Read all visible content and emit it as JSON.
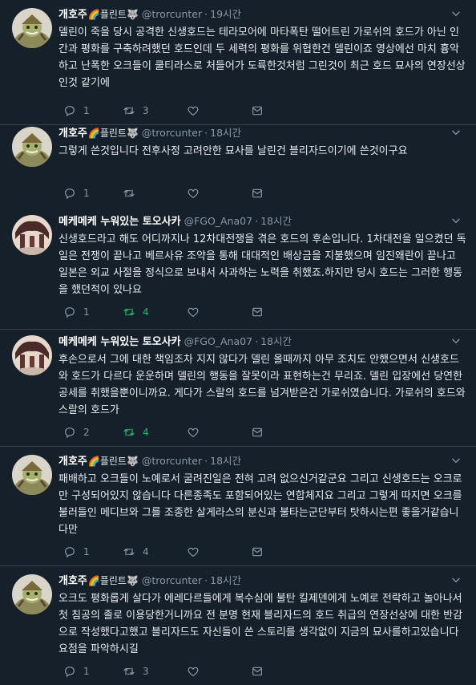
{
  "tweets": [
    {
      "name": "개호주",
      "emoji": "🌈플린트🐺",
      "handle": "@trorcunter",
      "time": "19시간",
      "text": "델린이 죽을 당시 공격한 신생호드는 테라모어에 마타폭탄 떨어트린 가로쉬의 호드가 아닌 인간과 평화를 구축하려했던 호드인데 두 세력의 평화를 위협한건 델린이죠 영상에선 마치  흉악하고 난폭한 오크들이 쿨티라스로 처들어가 도륙한것처럼 그린것이 최근 호드 묘사의 연장선상인것 같기에",
      "replies": "1",
      "retweets": "3",
      "retweet_color": "#8899a6",
      "likes": "",
      "avatar": "orc"
    },
    {
      "name": "개호주",
      "emoji": "🌈플린트🐺",
      "handle": "@trorcunter",
      "time": "18시간",
      "text": "그렇게 쓴것입니다 전후사정 고려안한 묘사를 날린건 블리자드이기에 쓴것이구요",
      "replies": "1",
      "retweets": "",
      "retweet_color": "#8899a6",
      "likes": "",
      "avatar": "orc"
    },
    {
      "name": "메케메케 누워있는 토오사카",
      "emoji": "",
      "handle": "@FGO_Ana07",
      "time": "18시간",
      "text": "신생호드라고 해도 어디까지나 12차대전쟁을 겪은 호드의 후손입니다. 1차대전을 일으켰던 독일은 전쟁이 끝나고 베르사유 조약을 통해 대대적인 배상금을 지불했으며 임진왜란이 끝나고 일본은 외교 사절을 정식으로 보내서 사과하는 노력을 취했죠.하지만 당시 호드는 그러한 행동을 했던적이 있나요",
      "replies": "1",
      "retweets": "4",
      "retweet_color": "#17bf63",
      "likes": "",
      "avatar": "anime"
    },
    {
      "name": "메케메케 누워있는 토오사카",
      "emoji": "",
      "handle": "@FGO_Ana07",
      "time": "18시간",
      "text": "후손으로서 그에 대한 책임조차 지지 않다가 델린 올때까지 아무 조치도 안했으면서 신생호드와 호드가 다르다 운운하며 델린의 행동을 잘못이라 표현하는건 무리죠. 델린 입장에선 당연한 공세를 취했을뿐이니까요. 게다가 스랄의 호드를 넘겨받은건 가로쉬였습니다. 가로쉬의 호드와 스랄의 호드가",
      "replies": "2",
      "retweets": "4",
      "retweet_color": "#17bf63",
      "likes": "",
      "avatar": "anime"
    },
    {
      "name": "개호주",
      "emoji": "🌈플린트🐺",
      "handle": "@trorcunter",
      "time": "18시간",
      "text": "패배하고 오크들이 노예로서 굴려진일은 전혀 고려 없으신거같군요 그리고 신생호드는 오크로만 구성되어있지 않습니다 다른종족도 포함되어있는 연합체지요 그리고 그렇게 따지면 오크를 불러들인 메디브와 그를 조종한 살게라스의 분신과 불타는군단부터 탓하시는편 좋을거같습니다만",
      "replies": "1",
      "retweets": "4",
      "retweet_color": "#8899a6",
      "likes": "",
      "avatar": "orc"
    },
    {
      "name": "개호주",
      "emoji": "🌈플린트🐺",
      "handle": "@trorcunter",
      "time": "18시간",
      "text": "오크도 평화롭게 살다가 에레다르들에게 복수심에 불탄 킬제덴에게 노예로 전락하고 놀아나서 첫 침공의 졸로 이용당한거니까요 전 분명 현재 블리자드의 호드 취급의 연장선상에 대한 반감으로 작성했다고했고 블리자드도 자신들이 쓴 스토리를 생각없이 지금의 묘사를하고있습니다 요점을 파악하시길",
      "replies": "1",
      "retweets": "3",
      "retweet_color": "#8899a6",
      "likes": "",
      "avatar": "orc"
    }
  ],
  "icons": {
    "reply": "reply-icon",
    "retweet": "retweet-icon",
    "like": "heart-icon",
    "share": "share-icon",
    "menu": "chevron-down-icon"
  },
  "colors": {
    "background": "#15202b",
    "text": "#e6ecf0",
    "muted": "#8899a6",
    "retweeted": "#17bf63",
    "divider": "#38444d"
  }
}
